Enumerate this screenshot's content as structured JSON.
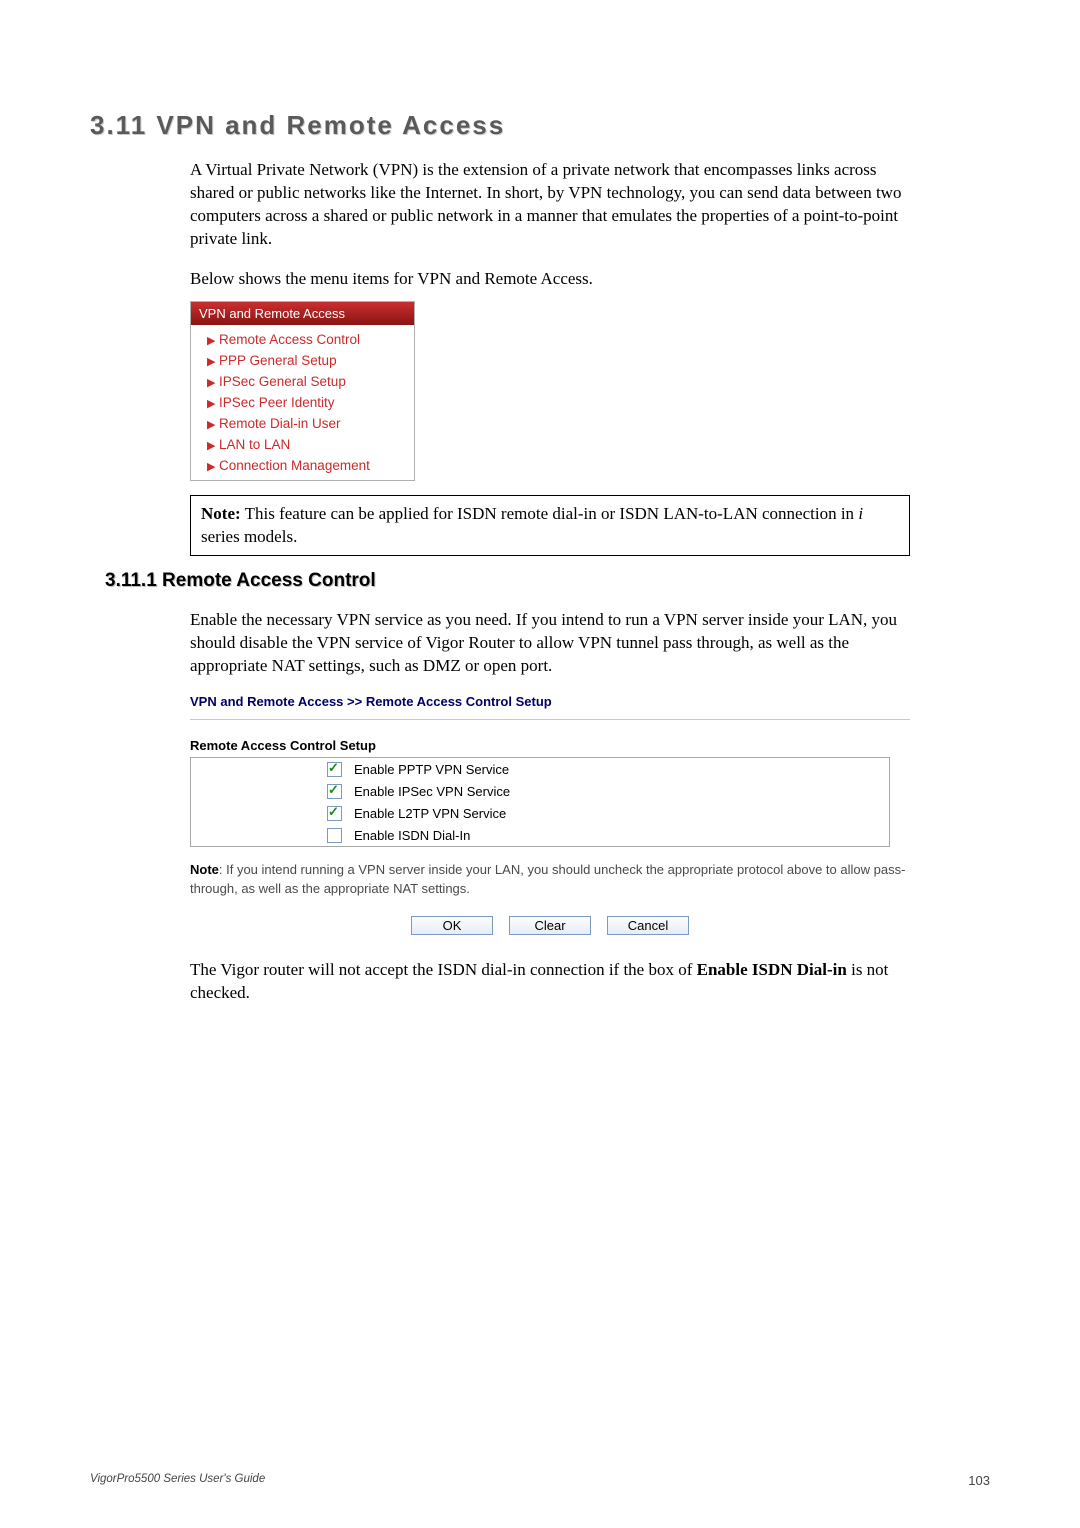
{
  "section": {
    "number_title": "3.11 VPN and Remote Access",
    "intro_para": "A Virtual Private Network (VPN) is the extension of a private network that encompasses links across shared or public networks like the Internet. In short, by VPN technology, you can send data between two computers across a shared or public network in a manner that emulates the properties of a point-to-point private link.",
    "below_line": "Below shows the menu items for VPN and Remote Access."
  },
  "menu": {
    "title": "VPN and Remote Access",
    "items": [
      "Remote Access Control",
      "PPP General Setup",
      "IPSec General Setup",
      "IPSec Peer Identity",
      "Remote Dial-in User",
      "LAN to LAN",
      "Connection Management"
    ]
  },
  "note_box": {
    "prefix": "Note:",
    "text_before_i": " This feature can be applied for ISDN remote dial-in or ISDN LAN-to-LAN connection in ",
    "italic": "i",
    "text_after_i": " series models."
  },
  "subsection": {
    "title": "3.11.1 Remote Access Control",
    "para": "Enable the necessary VPN service as you need. If you intend to run a VPN server inside your LAN, you should disable the VPN service of Vigor Router to allow VPN tunnel pass through, as well as the appropriate NAT settings, such as DMZ or open port."
  },
  "setup": {
    "breadcrumb": "VPN and Remote Access >> Remote Access Control Setup",
    "table_title": "Remote Access Control Setup",
    "options": [
      {
        "label": "Enable PPTP VPN Service",
        "checked": true
      },
      {
        "label": "Enable IPSec VPN Service",
        "checked": true
      },
      {
        "label": "Enable L2TP VPN Service",
        "checked": true
      },
      {
        "label": "Enable ISDN Dial-In",
        "checked": false
      }
    ],
    "ui_note_prefix": "Note",
    "ui_note_text": ": If you intend running a VPN server inside your LAN, you should uncheck the appropriate protocol above to allow pass-through, as well as the appropriate NAT settings.",
    "buttons": {
      "ok": "OK",
      "clear": "Clear",
      "cancel": "Cancel"
    }
  },
  "closing": {
    "pre": "The Vigor router will not accept the ISDN dial-in connection if the box of ",
    "bold": "Enable ISDN Dial-in",
    "post": " is not checked."
  },
  "footer": {
    "left": "VigorPro5500 Series User's Guide",
    "page": "103"
  }
}
